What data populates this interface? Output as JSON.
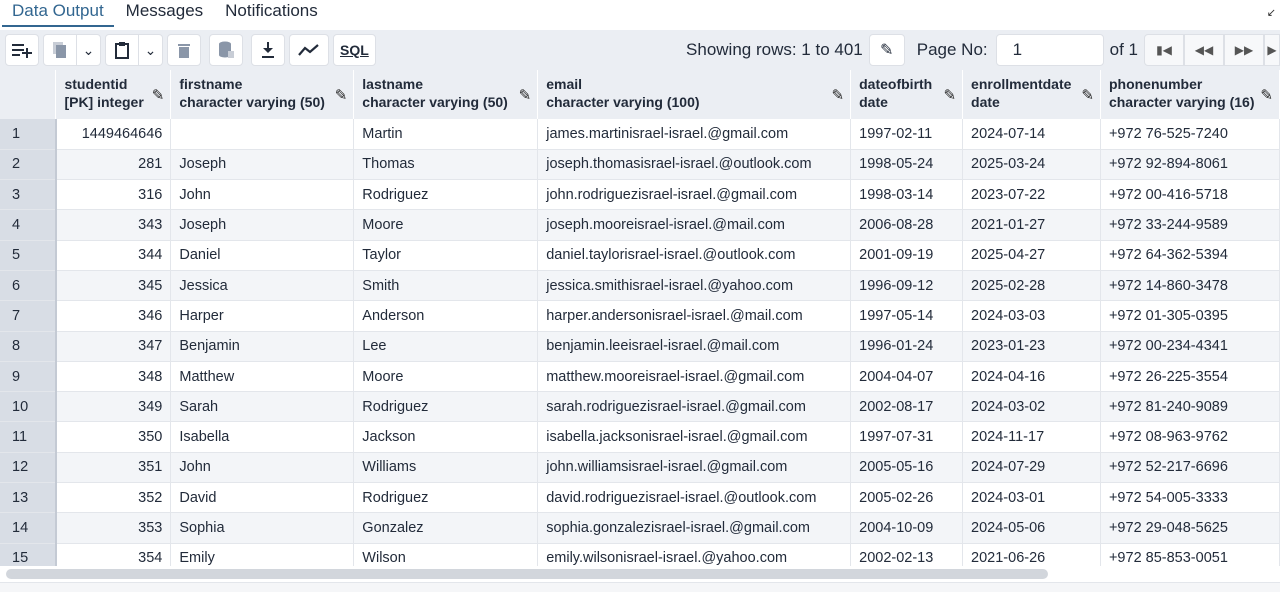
{
  "tabs": [
    {
      "label": "Data Output",
      "active": true
    },
    {
      "label": "Messages",
      "active": false
    },
    {
      "label": "Notifications",
      "active": false
    }
  ],
  "toolbar": {
    "add_row_icon": "add-row-icon",
    "copy_icon": "copy-icon",
    "paste_icon": "paste-icon",
    "delete_icon": "trash-icon",
    "save_data_icon": "database-save-icon",
    "download_icon": "download-icon",
    "graph_icon": "chart-line-icon",
    "sql_label": "SQL",
    "rows_label": "Showing rows: 1 to 401",
    "page_label": "Page No:",
    "page_value": "1",
    "of_label": "of 1"
  },
  "columns": [
    {
      "name": "studentid",
      "type": "[PK] integer"
    },
    {
      "name": "firstname",
      "type": "character varying (50)"
    },
    {
      "name": "lastname",
      "type": "character varying (50)"
    },
    {
      "name": "email",
      "type": "character varying (100)"
    },
    {
      "name": "dateofbirth",
      "type": "date"
    },
    {
      "name": "enrollmentdate",
      "type": "date"
    },
    {
      "name": "phonenumber",
      "type": "character varying (16)"
    }
  ],
  "rows": [
    [
      "1",
      "1449464646",
      "",
      "Martin",
      "james.martinisrael-israel.@gmail.com",
      "1997-02-11",
      "2024-07-14",
      "+972 76-525-7240"
    ],
    [
      "2",
      "281",
      "Joseph",
      "Thomas",
      "joseph.thomasisrael-israel.@outlook.com",
      "1998-05-24",
      "2025-03-24",
      "+972 92-894-8061"
    ],
    [
      "3",
      "316",
      "John",
      "Rodriguez",
      "john.rodriguezisrael-israel.@gmail.com",
      "1998-03-14",
      "2023-07-22",
      "+972 00-416-5718"
    ],
    [
      "4",
      "343",
      "Joseph",
      "Moore",
      "joseph.mooreisrael-israel.@mail.com",
      "2006-08-28",
      "2021-01-27",
      "+972 33-244-9589"
    ],
    [
      "5",
      "344",
      "Daniel",
      "Taylor",
      "daniel.taylorisrael-israel.@outlook.com",
      "2001-09-19",
      "2025-04-27",
      "+972 64-362-5394"
    ],
    [
      "6",
      "345",
      "Jessica",
      "Smith",
      "jessica.smithisrael-israel.@yahoo.com",
      "1996-09-12",
      "2025-02-28",
      "+972 14-860-3478"
    ],
    [
      "7",
      "346",
      "Harper",
      "Anderson",
      "harper.andersonisrael-israel.@mail.com",
      "1997-05-14",
      "2024-03-03",
      "+972 01-305-0395"
    ],
    [
      "8",
      "347",
      "Benjamin",
      "Lee",
      "benjamin.leeisrael-israel.@mail.com",
      "1996-01-24",
      "2023-01-23",
      "+972 00-234-4341"
    ],
    [
      "9",
      "348",
      "Matthew",
      "Moore",
      "matthew.mooreisrael-israel.@gmail.com",
      "2004-04-07",
      "2024-04-16",
      "+972 26-225-3554"
    ],
    [
      "10",
      "349",
      "Sarah",
      "Rodriguez",
      "sarah.rodriguezisrael-israel.@gmail.com",
      "2002-08-17",
      "2024-03-02",
      "+972 81-240-9089"
    ],
    [
      "11",
      "350",
      "Isabella",
      "Jackson",
      "isabella.jacksonisrael-israel.@gmail.com",
      "1997-07-31",
      "2024-11-17",
      "+972 08-963-9762"
    ],
    [
      "12",
      "351",
      "John",
      "Williams",
      "john.williamsisrael-israel.@gmail.com",
      "2005-05-16",
      "2024-07-29",
      "+972 52-217-6696"
    ],
    [
      "13",
      "352",
      "David",
      "Rodriguez",
      "david.rodriguezisrael-israel.@outlook.com",
      "2005-02-26",
      "2024-03-01",
      "+972 54-005-3333"
    ],
    [
      "14",
      "353",
      "Sophia",
      "Gonzalez",
      "sophia.gonzalezisrael-israel.@gmail.com",
      "2004-10-09",
      "2024-05-06",
      "+972 29-048-5625"
    ],
    [
      "15",
      "354",
      "Emily",
      "Wilson",
      "emily.wilsonisrael-israel.@yahoo.com",
      "2002-02-13",
      "2021-06-26",
      "+972 85-853-0051"
    ]
  ]
}
